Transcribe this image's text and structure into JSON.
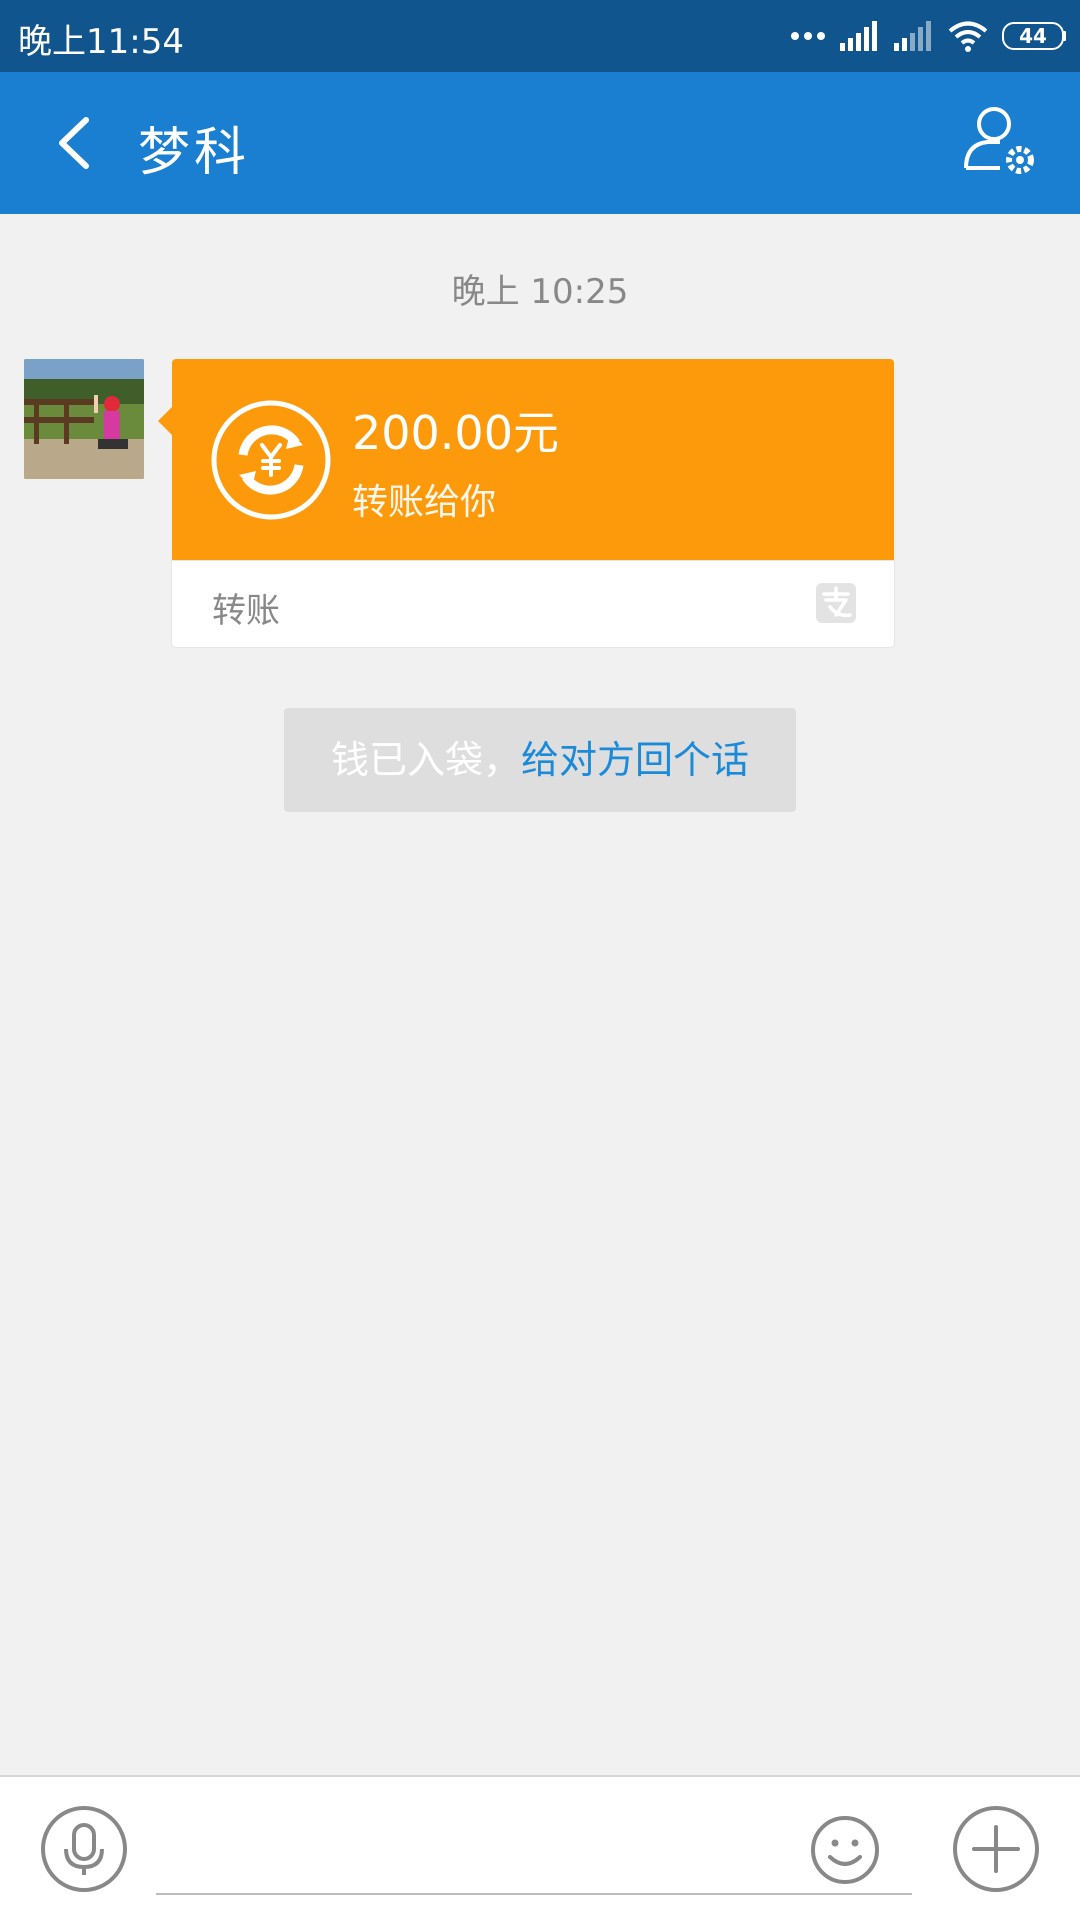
{
  "status_bar": {
    "time": "晚上11:54",
    "battery": "44",
    "icons": [
      "more-dots-icon",
      "signal-icon",
      "signal-weak-icon",
      "wifi-icon",
      "battery-icon"
    ]
  },
  "header": {
    "title": "梦科",
    "back_icon": "chevron-left-icon",
    "profile_icon": "user-settings-icon"
  },
  "chat": {
    "timestamp": "晚上 10:25",
    "message": {
      "type": "transfer",
      "amount": "200.00元",
      "description": "转账给你",
      "label": "转账",
      "icon": "transfer-yuan-icon",
      "brand_icon": "alipay-icon"
    },
    "notice": {
      "text": "钱已入袋，",
      "link": "给对方回个话"
    }
  },
  "input_bar": {
    "placeholder": "",
    "voice_icon": "microphone-icon",
    "emoji_icon": "smiley-icon",
    "plus_icon": "plus-icon"
  },
  "colors": {
    "status_bar": "#11558f",
    "header": "#1b7fd1",
    "transfer_card": "#fd9a0b",
    "link": "#1b8ad8",
    "background": "#f1f1f1"
  }
}
